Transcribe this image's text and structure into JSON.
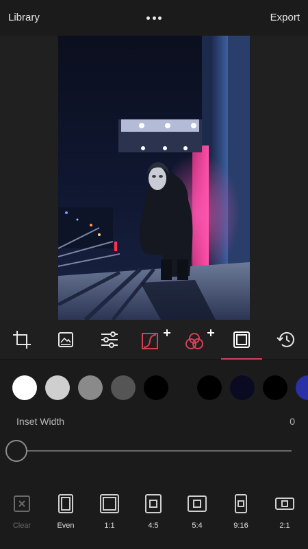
{
  "header": {
    "left_label": "Library",
    "right_label": "Export"
  },
  "toolbar": {
    "active_index": 5,
    "accent": "#d94055",
    "items": [
      "crop-icon",
      "image-frame-icon",
      "sliders-icon",
      "curves-icon",
      "hsl-circles-icon",
      "border-icon",
      "history-icon"
    ]
  },
  "swatches": [
    "#ffffff",
    "#cfcfcf",
    "#8a8a8a",
    "#555555",
    "#000000",
    "#000000",
    "#0a0b22",
    "#000000",
    "#2a30a6"
  ],
  "inset": {
    "label": "Inset Width",
    "value": "0",
    "slider_fraction": 0
  },
  "aspects": {
    "clear": "Clear",
    "even": "Even",
    "ratio_1_1": "1:1",
    "ratio_4_5": "4:5",
    "ratio_5_4": "5:4",
    "ratio_9_16": "9:16",
    "ratio_2_1": "2:1"
  }
}
